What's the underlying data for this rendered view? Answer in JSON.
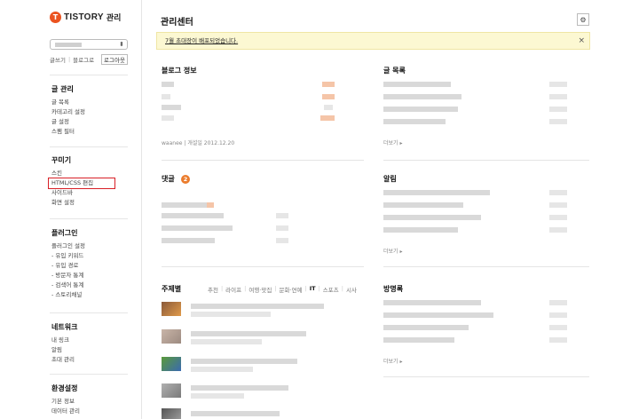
{
  "app": {
    "logo_mark": "T",
    "logo_text": "TISTORY",
    "logo_sub": "관리"
  },
  "sidebar": {
    "quick_links": [
      "글쓰기",
      "블로그로"
    ],
    "logout_label": "로그아웃",
    "groups": [
      {
        "title": "글 관리",
        "items": [
          "글 목록",
          "카테고리 설정",
          "글 설정",
          "스팸 필터"
        ]
      },
      {
        "title": "꾸미기",
        "items": [
          "스킨",
          "HTML/CSS 편집",
          "사이드바",
          "화면 설정"
        ]
      },
      {
        "title": "플러그인",
        "items": [
          "플러그인 설정",
          "- 유입 키워드",
          "- 유입 경로",
          "- 방문자 통계",
          "- 검색어 통계",
          "- 스토리채널"
        ]
      },
      {
        "title": "네트워크",
        "items": [
          "내 링크",
          "알림",
          "초대 관리"
        ]
      },
      {
        "title": "환경설정",
        "items": [
          "기본 정보",
          "데이터 관리"
        ]
      }
    ],
    "selected_item": "HTML/CSS 편집"
  },
  "main": {
    "title": "관리센터",
    "notice": "7월 초대장이 배포되었습니다.",
    "notice_close": "×",
    "blog_info": {
      "title": "블로그 정보",
      "meta_user": "waanee",
      "meta_sep": "|",
      "meta_open": "개설일 2012.12.20"
    },
    "posts": {
      "title": "글 목록",
      "more": "더보기 ▸"
    },
    "comments": {
      "title": "댓글",
      "badge": "2"
    },
    "alerts": {
      "title": "알림",
      "more": "더보기 ▸"
    },
    "topics": {
      "title": "주제별",
      "tabs": [
        "추천",
        "라이프",
        "여행·맛집",
        "문화·연예",
        "IT",
        "스포츠",
        "시사"
      ],
      "active_tab": "IT"
    },
    "guestbook": {
      "title": "방명록",
      "more": "더보기 ▸"
    }
  },
  "colors": {
    "brand": "#eb531f",
    "notice_bg": "#fcf8d2",
    "selected_outline": "#d81f26"
  }
}
